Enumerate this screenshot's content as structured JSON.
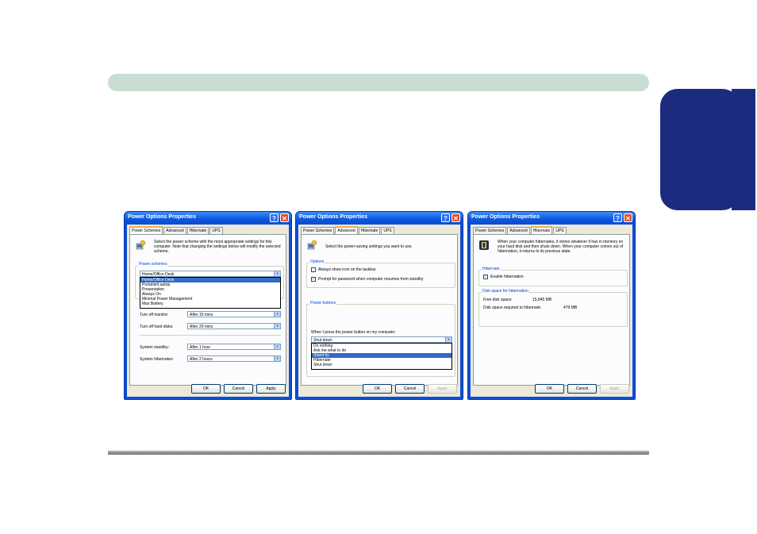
{
  "document": {
    "side_tab_color": "#1d2b7e",
    "header_bar_color": "#c9ddd3"
  },
  "windows": [
    {
      "title": "Power Options Properties",
      "tabs": [
        "Power Schemes",
        "Advanced",
        "Hibernate",
        "UPS"
      ],
      "selected_tab": "Power Schemes",
      "description": "Select the power scheme with the most appropriate settings for this computer. Note that changing the settings below will modify the selected scheme.",
      "group_label": "Power schemes",
      "scheme_selected": "Home/Office Desk",
      "scheme_options": [
        "Home/Office Desk",
        "Portable/Laptop",
        "Presentation",
        "Always On",
        "Minimal Power Management",
        "Max Battery"
      ],
      "settings": [
        {
          "label": "Turn off monitor:",
          "value": "After 15 mins"
        },
        {
          "label": "Turn off hard disks:",
          "value": "After 20 mins"
        },
        {
          "label": "System standby:",
          "value": "After 1 hour"
        },
        {
          "label": "System hibernates:",
          "value": "After 2 hours"
        }
      ],
      "buttons": {
        "ok": "OK",
        "cancel": "Cancel",
        "apply": "Apply"
      }
    },
    {
      "title": "Power Options Properties",
      "tabs": [
        "Power Schemes",
        "Advanced",
        "Hibernate",
        "UPS"
      ],
      "selected_tab": "Advanced",
      "description": "Select the power-saving settings you want to use.",
      "options_label": "Options",
      "option1": "Always show icon on the taskbar",
      "option2": "Prompt for password when computer resumes from standby",
      "power_buttons_label": "Power buttons",
      "when_press_label": "When I press the power button on my computer:",
      "power_selected": "Shut down",
      "power_options": [
        "Do nothing",
        "Ask me what to do",
        "Stand by",
        "Hibernate",
        "Shut down"
      ],
      "buttons": {
        "ok": "OK",
        "cancel": "Cancel",
        "apply": "Apply"
      }
    },
    {
      "title": "Power Options Properties",
      "tabs": [
        "Power Schemes",
        "Advanced",
        "Hibernate",
        "UPS"
      ],
      "selected_tab": "Hibernate",
      "description": "When your computer hibernates, it stores whatever it has in memory on your hard disk and then shuts down. When your computer comes out of hibernation, it returns to its previous state.",
      "hibernate_label": "Hibernate",
      "enable_label": "Enable hibernation",
      "disk_label": "Disk space for hibernation",
      "free_label": "Free disk space:",
      "free_value": "15,845 MB",
      "required_label": "Disk space required to hibernate:",
      "required_value": "479 MB",
      "buttons": {
        "ok": "OK",
        "cancel": "Cancel",
        "apply": "Apply"
      }
    }
  ]
}
